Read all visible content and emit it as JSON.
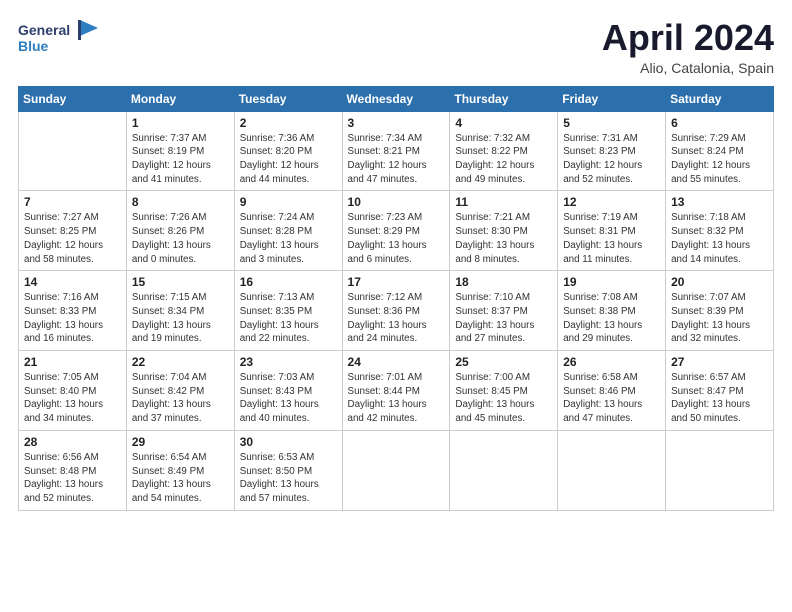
{
  "header": {
    "logo_line1": "General",
    "logo_line2": "Blue",
    "month_title": "April 2024",
    "location": "Alio, Catalonia, Spain"
  },
  "weekdays": [
    "Sunday",
    "Monday",
    "Tuesday",
    "Wednesday",
    "Thursday",
    "Friday",
    "Saturday"
  ],
  "weeks": [
    [
      {
        "day": "",
        "sunrise": "",
        "sunset": "",
        "daylight": ""
      },
      {
        "day": "1",
        "sunrise": "Sunrise: 7:37 AM",
        "sunset": "Sunset: 8:19 PM",
        "daylight": "Daylight: 12 hours and 41 minutes."
      },
      {
        "day": "2",
        "sunrise": "Sunrise: 7:36 AM",
        "sunset": "Sunset: 8:20 PM",
        "daylight": "Daylight: 12 hours and 44 minutes."
      },
      {
        "day": "3",
        "sunrise": "Sunrise: 7:34 AM",
        "sunset": "Sunset: 8:21 PM",
        "daylight": "Daylight: 12 hours and 47 minutes."
      },
      {
        "day": "4",
        "sunrise": "Sunrise: 7:32 AM",
        "sunset": "Sunset: 8:22 PM",
        "daylight": "Daylight: 12 hours and 49 minutes."
      },
      {
        "day": "5",
        "sunrise": "Sunrise: 7:31 AM",
        "sunset": "Sunset: 8:23 PM",
        "daylight": "Daylight: 12 hours and 52 minutes."
      },
      {
        "day": "6",
        "sunrise": "Sunrise: 7:29 AM",
        "sunset": "Sunset: 8:24 PM",
        "daylight": "Daylight: 12 hours and 55 minutes."
      }
    ],
    [
      {
        "day": "7",
        "sunrise": "Sunrise: 7:27 AM",
        "sunset": "Sunset: 8:25 PM",
        "daylight": "Daylight: 12 hours and 58 minutes."
      },
      {
        "day": "8",
        "sunrise": "Sunrise: 7:26 AM",
        "sunset": "Sunset: 8:26 PM",
        "daylight": "Daylight: 13 hours and 0 minutes."
      },
      {
        "day": "9",
        "sunrise": "Sunrise: 7:24 AM",
        "sunset": "Sunset: 8:28 PM",
        "daylight": "Daylight: 13 hours and 3 minutes."
      },
      {
        "day": "10",
        "sunrise": "Sunrise: 7:23 AM",
        "sunset": "Sunset: 8:29 PM",
        "daylight": "Daylight: 13 hours and 6 minutes."
      },
      {
        "day": "11",
        "sunrise": "Sunrise: 7:21 AM",
        "sunset": "Sunset: 8:30 PM",
        "daylight": "Daylight: 13 hours and 8 minutes."
      },
      {
        "day": "12",
        "sunrise": "Sunrise: 7:19 AM",
        "sunset": "Sunset: 8:31 PM",
        "daylight": "Daylight: 13 hours and 11 minutes."
      },
      {
        "day": "13",
        "sunrise": "Sunrise: 7:18 AM",
        "sunset": "Sunset: 8:32 PM",
        "daylight": "Daylight: 13 hours and 14 minutes."
      }
    ],
    [
      {
        "day": "14",
        "sunrise": "Sunrise: 7:16 AM",
        "sunset": "Sunset: 8:33 PM",
        "daylight": "Daylight: 13 hours and 16 minutes."
      },
      {
        "day": "15",
        "sunrise": "Sunrise: 7:15 AM",
        "sunset": "Sunset: 8:34 PM",
        "daylight": "Daylight: 13 hours and 19 minutes."
      },
      {
        "day": "16",
        "sunrise": "Sunrise: 7:13 AM",
        "sunset": "Sunset: 8:35 PM",
        "daylight": "Daylight: 13 hours and 22 minutes."
      },
      {
        "day": "17",
        "sunrise": "Sunrise: 7:12 AM",
        "sunset": "Sunset: 8:36 PM",
        "daylight": "Daylight: 13 hours and 24 minutes."
      },
      {
        "day": "18",
        "sunrise": "Sunrise: 7:10 AM",
        "sunset": "Sunset: 8:37 PM",
        "daylight": "Daylight: 13 hours and 27 minutes."
      },
      {
        "day": "19",
        "sunrise": "Sunrise: 7:08 AM",
        "sunset": "Sunset: 8:38 PM",
        "daylight": "Daylight: 13 hours and 29 minutes."
      },
      {
        "day": "20",
        "sunrise": "Sunrise: 7:07 AM",
        "sunset": "Sunset: 8:39 PM",
        "daylight": "Daylight: 13 hours and 32 minutes."
      }
    ],
    [
      {
        "day": "21",
        "sunrise": "Sunrise: 7:05 AM",
        "sunset": "Sunset: 8:40 PM",
        "daylight": "Daylight: 13 hours and 34 minutes."
      },
      {
        "day": "22",
        "sunrise": "Sunrise: 7:04 AM",
        "sunset": "Sunset: 8:42 PM",
        "daylight": "Daylight: 13 hours and 37 minutes."
      },
      {
        "day": "23",
        "sunrise": "Sunrise: 7:03 AM",
        "sunset": "Sunset: 8:43 PM",
        "daylight": "Daylight: 13 hours and 40 minutes."
      },
      {
        "day": "24",
        "sunrise": "Sunrise: 7:01 AM",
        "sunset": "Sunset: 8:44 PM",
        "daylight": "Daylight: 13 hours and 42 minutes."
      },
      {
        "day": "25",
        "sunrise": "Sunrise: 7:00 AM",
        "sunset": "Sunset: 8:45 PM",
        "daylight": "Daylight: 13 hours and 45 minutes."
      },
      {
        "day": "26",
        "sunrise": "Sunrise: 6:58 AM",
        "sunset": "Sunset: 8:46 PM",
        "daylight": "Daylight: 13 hours and 47 minutes."
      },
      {
        "day": "27",
        "sunrise": "Sunrise: 6:57 AM",
        "sunset": "Sunset: 8:47 PM",
        "daylight": "Daylight: 13 hours and 50 minutes."
      }
    ],
    [
      {
        "day": "28",
        "sunrise": "Sunrise: 6:56 AM",
        "sunset": "Sunset: 8:48 PM",
        "daylight": "Daylight: 13 hours and 52 minutes."
      },
      {
        "day": "29",
        "sunrise": "Sunrise: 6:54 AM",
        "sunset": "Sunset: 8:49 PM",
        "daylight": "Daylight: 13 hours and 54 minutes."
      },
      {
        "day": "30",
        "sunrise": "Sunrise: 6:53 AM",
        "sunset": "Sunset: 8:50 PM",
        "daylight": "Daylight: 13 hours and 57 minutes."
      },
      {
        "day": "",
        "sunrise": "",
        "sunset": "",
        "daylight": ""
      },
      {
        "day": "",
        "sunrise": "",
        "sunset": "",
        "daylight": ""
      },
      {
        "day": "",
        "sunrise": "",
        "sunset": "",
        "daylight": ""
      },
      {
        "day": "",
        "sunrise": "",
        "sunset": "",
        "daylight": ""
      }
    ]
  ]
}
